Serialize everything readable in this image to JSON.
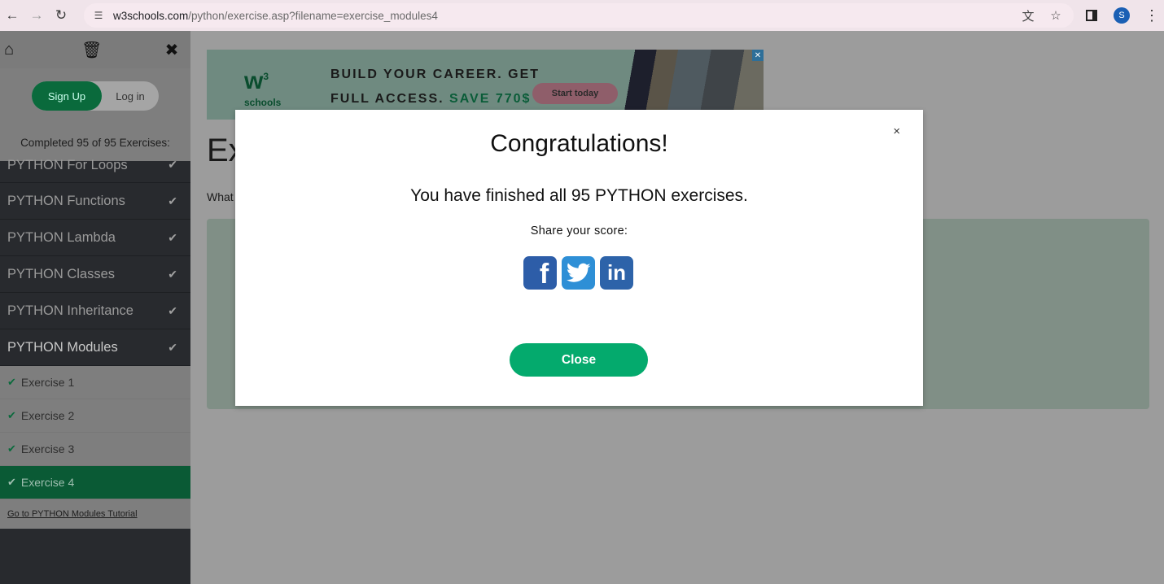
{
  "browser": {
    "url_domain": "w3schools.com",
    "url_path": "/python/exercise.asp?filename=exercise_modules4",
    "profile_initial": "S"
  },
  "sidebar": {
    "signup_label": "Sign Up",
    "login_label": "Log in",
    "completed_text": "Completed 95 of 95 Exercises:",
    "topics": [
      {
        "label": "PYTHON For Loops"
      },
      {
        "label": "PYTHON Functions"
      },
      {
        "label": "PYTHON Lambda"
      },
      {
        "label": "PYTHON Classes"
      },
      {
        "label": "PYTHON Inheritance"
      },
      {
        "label": "PYTHON Modules"
      }
    ],
    "exercises": [
      {
        "label": "Exercise 1"
      },
      {
        "label": "Exercise 2"
      },
      {
        "label": "Exercise 3"
      },
      {
        "label": "Exercise 4"
      }
    ],
    "tutorial_link": "Go to PYTHON Modules Tutorial"
  },
  "ad": {
    "logo_text": "schools",
    "headline_line1": "BUILD YOUR CAREER. GET",
    "headline_line2_prefix": "FULL ACCESS.",
    "headline_save": "SAVE 770$",
    "cta_label": "Start today"
  },
  "background": {
    "title_partial": "Ex",
    "question_partial": "What"
  },
  "modal": {
    "title": "Congratulations!",
    "message": "You have finished all 95 PYTHON exercises.",
    "share_label": "Share your score:",
    "close_label": "Close",
    "close_x": "×"
  },
  "colors": {
    "accent_green": "#04aa6d",
    "facebook": "#2d5da8",
    "twitter": "#2e8fd6",
    "linkedin": "#2d63a9"
  }
}
